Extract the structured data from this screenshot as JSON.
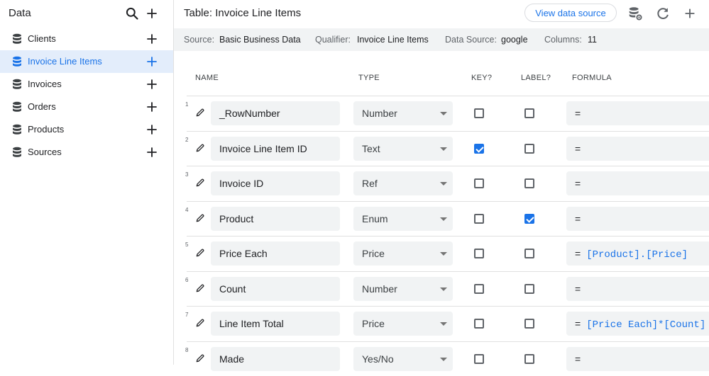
{
  "sidebar": {
    "title": "Data",
    "items": [
      {
        "label": "Clients",
        "active": false
      },
      {
        "label": "Invoice Line Items",
        "active": true
      },
      {
        "label": "Invoices",
        "active": false
      },
      {
        "label": "Orders",
        "active": false
      },
      {
        "label": "Products",
        "active": false
      },
      {
        "label": "Sources",
        "active": false
      }
    ]
  },
  "toolbar": {
    "title": "Table: Invoice Line Items",
    "view_source_label": "View data source"
  },
  "info": {
    "source_label": "Source:",
    "source_value": "Basic Business Data",
    "qualifier_label": "Qualifier:",
    "qualifier_value": "Invoice Line Items",
    "datasource_label": "Data Source:",
    "datasource_value": "google",
    "columns_label": "Columns:",
    "columns_value": "11"
  },
  "headers": {
    "name": "NAME",
    "type": "TYPE",
    "key": "KEY?",
    "label": "LABEL?",
    "formula": "FORMULA"
  },
  "rows": [
    {
      "num": "1",
      "name": "_RowNumber",
      "type": "Number",
      "key": false,
      "label": false,
      "formula_eq": "=",
      "formula": ""
    },
    {
      "num": "2",
      "name": "Invoice Line Item ID",
      "type": "Text",
      "key": true,
      "label": false,
      "formula_eq": "=",
      "formula": ""
    },
    {
      "num": "3",
      "name": "Invoice ID",
      "type": "Ref",
      "key": false,
      "label": false,
      "formula_eq": "=",
      "formula": ""
    },
    {
      "num": "4",
      "name": "Product",
      "type": "Enum",
      "key": false,
      "label": true,
      "formula_eq": "=",
      "formula": ""
    },
    {
      "num": "5",
      "name": "Price Each",
      "type": "Price",
      "key": false,
      "label": false,
      "formula_eq": "=",
      "formula": "[Product].[Price]"
    },
    {
      "num": "6",
      "name": "Count",
      "type": "Number",
      "key": false,
      "label": false,
      "formula_eq": "=",
      "formula": ""
    },
    {
      "num": "7",
      "name": "Line Item Total",
      "type": "Price",
      "key": false,
      "label": false,
      "formula_eq": "=",
      "formula": "[Price Each]*[Count]"
    },
    {
      "num": "8",
      "name": "Made",
      "type": "Yes/No",
      "key": false,
      "label": false,
      "formula_eq": "=",
      "formula": ""
    }
  ],
  "colors": {
    "accent": "#1a73e8",
    "active_bg": "#e3edfb",
    "field_bg": "#f1f3f4"
  }
}
